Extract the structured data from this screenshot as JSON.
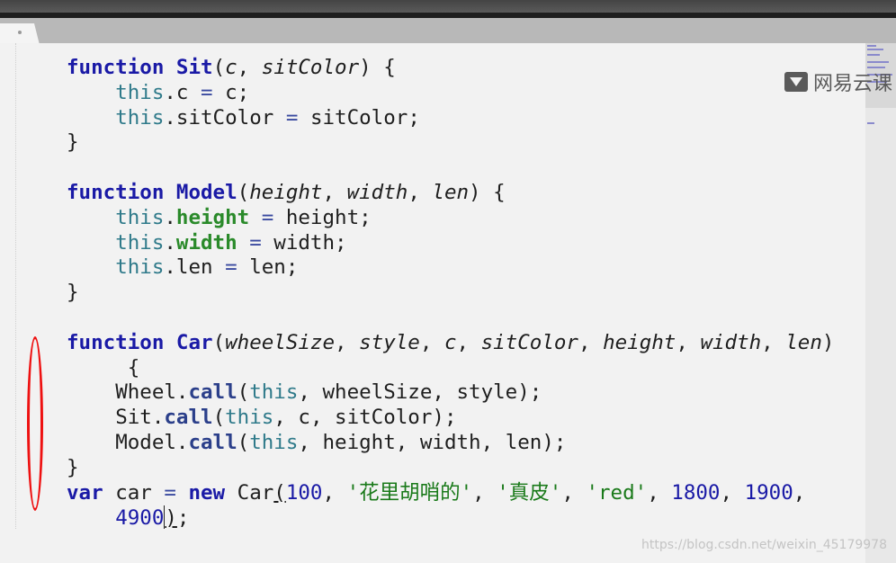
{
  "watermark": {
    "brand": "网易云课",
    "url": "https://blog.csdn.net/weixin_45179978"
  },
  "code": {
    "kw_function": "function",
    "kw_this": "this",
    "kw_var": "var",
    "kw_new": "new",
    "sit_name": "Sit",
    "sit_params": [
      "c",
      "sitColor"
    ],
    "model_name": "Model",
    "model_params": [
      "height",
      "width",
      "len"
    ],
    "car_name": "Car",
    "car_params": [
      "wheelSize",
      "style",
      "c",
      "sitColor",
      "height",
      "width",
      "len"
    ],
    "prop_c": "c",
    "prop_sitColor": "sitColor",
    "prop_height": "height",
    "prop_width": "width",
    "prop_len": "len",
    "call_method": "call",
    "wheel": "Wheel",
    "car_var": "car",
    "args": {
      "n1": "100",
      "s1": "'花里胡哨的'",
      "s2": "'真皮'",
      "s3": "'red'",
      "n2": "1800",
      "n3": "1900",
      "n4": "4900"
    }
  },
  "colors": {
    "keyword": "#1a1aa6",
    "this": "#2f7a8a",
    "property": "#2a8a2a",
    "string": "#1a7a1a",
    "annotation": "#ee1111"
  }
}
